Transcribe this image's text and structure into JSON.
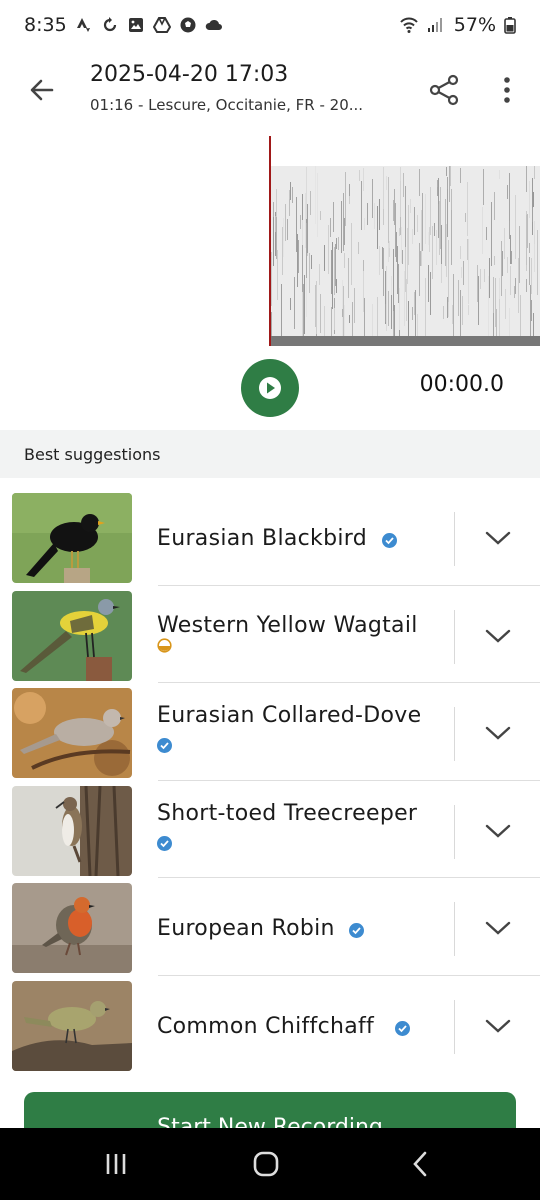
{
  "status_bar": {
    "time": "8:35",
    "battery": "57%",
    "left_icons": [
      "strava-icon",
      "sync-icon",
      "gallery-icon",
      "drive-icon",
      "soccer-icon",
      "cloud-icon"
    ],
    "right_icons": [
      "wifi-icon",
      "signal-icon",
      "battery-icon"
    ]
  },
  "header": {
    "title": "2025-04-20 17:03",
    "subtitle": "01:16 - Lescure, Occitanie, FR - 20..."
  },
  "player": {
    "timer": "00:00.0",
    "accent_color": "#2f7d45",
    "playhead_color": "#a01818"
  },
  "suggestions": {
    "section_title": "Best suggestions",
    "items": [
      {
        "name": "Eurasian Blackbird",
        "status": "verified"
      },
      {
        "name": "Western Yellow Wagtail",
        "status": "partial"
      },
      {
        "name": "Eurasian Collared-Dove",
        "status": "verified"
      },
      {
        "name": "Short-toed Treecreeper",
        "status": "verified"
      },
      {
        "name": "European Robin",
        "status": "verified"
      },
      {
        "name": "Common Chiffchaff",
        "status": "verified"
      }
    ]
  },
  "actions": {
    "start_label": "Start New Recording"
  },
  "colors": {
    "verified": "#3d8bd0",
    "partial": "#d8951a",
    "section_bg": "#f2f3f3"
  }
}
